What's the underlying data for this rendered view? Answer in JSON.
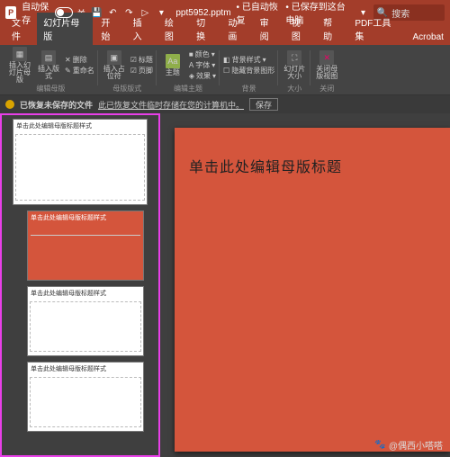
{
  "titlebar": {
    "autosave_label": "自动保存",
    "autosave_state": "关",
    "filename": "ppt5952.pptm",
    "recovered": "已自动恢复",
    "saved_local": "已保存到这台电脑",
    "search_placeholder": "搜索"
  },
  "tabs": [
    "文件",
    "幻灯片母版",
    "开始",
    "插入",
    "绘图",
    "切换",
    "动画",
    "审阅",
    "视图",
    "帮助",
    "PDF工具集",
    "Acrobat"
  ],
  "active_tab_index": 1,
  "ribbon": {
    "insert_master": "插入幻灯片母版",
    "insert_layout": "插入版式",
    "rename": "重命名",
    "delete": "删除",
    "insert_placeholder": "插入占位符",
    "title": "标题",
    "footers": "页脚",
    "theme": "主题",
    "colors": "颜色",
    "fonts": "字体",
    "effects": "效果",
    "bg_styles": "背景样式",
    "hide_bg": "隐藏背景图形",
    "slide_size": "幻灯片大小",
    "close_master": "关闭母版视图",
    "group_edit_master": "编辑母版",
    "group_master_layout": "母版版式",
    "group_edit_theme": "编辑主题",
    "group_background": "背景",
    "group_size": "大小",
    "group_close": "关闭"
  },
  "recovery": {
    "title": "已恢复未保存的文件",
    "msg": "此已恢复文件临时存储在您的计算机中。",
    "save": "保存"
  },
  "thumbnails": {
    "master_title": "单击此处编辑母版标题样式",
    "layout_title": "单击此处编辑母版标题样式"
  },
  "slide": {
    "title_text": "单击此处编辑母版标题"
  },
  "watermark": {
    "author": "@偶西小嗒嗒"
  }
}
